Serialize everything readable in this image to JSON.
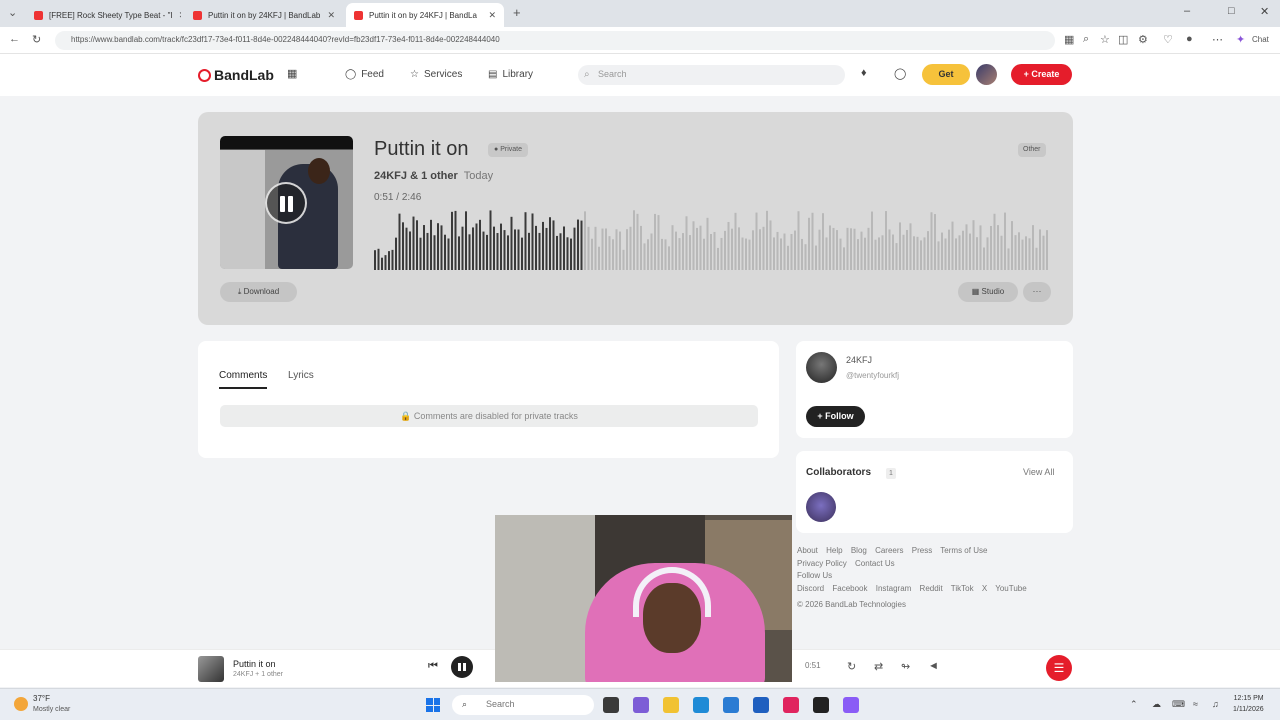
{
  "browser": {
    "tabs": [
      {
        "label": "[FREE] Rock Sheety Type Beat - \"I"
      },
      {
        "label": "Puttin it on by 24KFJ | BandLab"
      },
      {
        "label": "Puttin it on by 24KFJ | BandLa"
      }
    ],
    "url": "https://www.bandlab.com/track/fc23df17-73e4-f011-8d4e-002248444040?revId=fb23df17-73e4-f011-8d4e-002248444040",
    "new_tab_glyph": "+",
    "profile_label": "Chat"
  },
  "header": {
    "logo_text": "BandLab",
    "nav": [
      {
        "label": "Feed",
        "icon": "feed-icon"
      },
      {
        "label": "Services",
        "icon": "star-icon"
      },
      {
        "label": "Library",
        "icon": "library-icon"
      }
    ],
    "search_placeholder": "Search",
    "get_label": "Get",
    "create_label": "+ Create",
    "accent": "#e51d2b",
    "get_color": "#f6c23b"
  },
  "track": {
    "title": "Puttin it on",
    "privacy_badge": "Private",
    "other_badge": "Other",
    "artists": "24KFJ & 1 other",
    "posted": "Today",
    "current_time": "0:51",
    "time_separator": "/",
    "duration": "2:46",
    "progress": 0.307,
    "download_label": "Download",
    "studio_label": "Studio",
    "more_label": "···"
  },
  "comments": {
    "tabs": [
      "Comments",
      "Lyrics"
    ],
    "disabled_text": "Comments are disabled for private tracks"
  },
  "artist": {
    "name": "24KFJ",
    "handle": "@twentyfourkfj",
    "follow_label": "+ Follow"
  },
  "collaborators": {
    "title": "Collaborators",
    "count": "1",
    "view_all": "View All"
  },
  "footer": {
    "links_row1": [
      "About",
      "Help",
      "Blog",
      "Careers",
      "Press",
      "Terms of Use"
    ],
    "links_row2": [
      "Privacy Policy",
      "Contact Us"
    ],
    "follow_us": "Follow Us",
    "social": [
      "Discord",
      "Facebook",
      "Instagram",
      "Reddit",
      "TikTok",
      "X",
      "YouTube"
    ],
    "copyright": "© 2026 BandLab Technologies"
  },
  "player": {
    "title": "Puttin it on",
    "artists": "24KFJ + 1 other",
    "time": "0:51"
  },
  "taskbar": {
    "temp": "37°F",
    "weather": "Mostly clear",
    "search_placeholder": "Search",
    "time": "12:15 PM",
    "date": "1/11/2026"
  }
}
